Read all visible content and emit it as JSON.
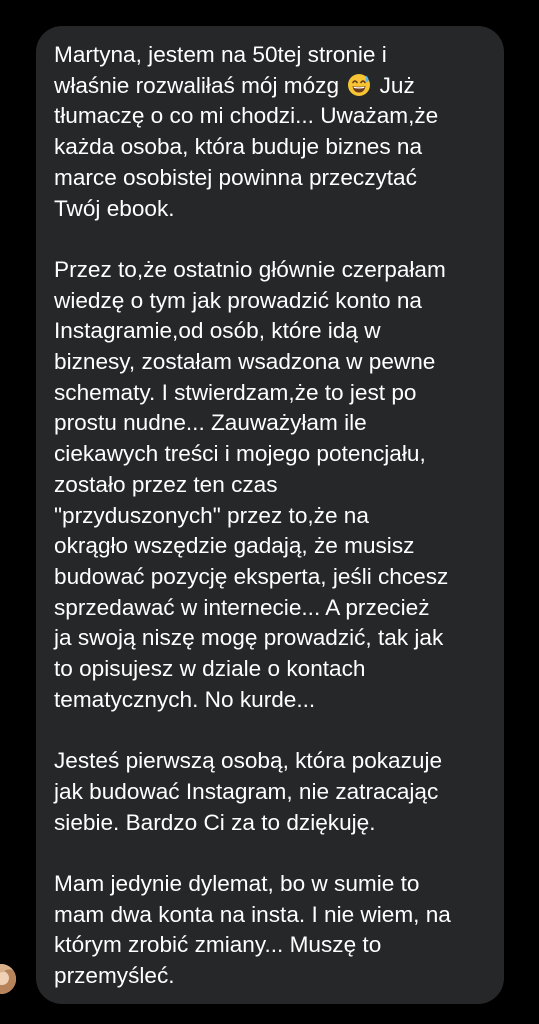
{
  "message": {
    "paragraphs": [
      {
        "before_emoji": "Martyna, jestem na 50tej stronie i\nwłaśnie rozwaliłaś mój mózg ",
        "emoji": "grinning-face-with-sweat-icon",
        "after_emoji": " Już\ntłumaczę o co mi chodzi... Uważam,że\nkażda osoba, która buduje biznes na\nmarce osobistej powinna przeczytać\nTwój ebook."
      },
      {
        "text": "Przez to,że ostatnio głównie czerpałam\nwiedzę o tym jak prowadzić konto na\nInstagramie,od osób, które idą w\nbiznesy, zostałam wsadzona w pewne\nschematy. I stwierdzam,że to jest po\nprostu nudne... Zauważyłam ile\nciekawych treści i mojego potencjału,\nzostało przez ten czas\n\"przyduszonych\" przez to,że na\nokrągło wszędzie gadają, że musisz\nbudować pozycję eksperta, jeśli chcesz\nsprzedawać w internecie... A przecież\nja swoją niszę mogę prowadzić, tak jak\nto opisujesz w dziale o kontach\ntematycznych. No kurde..."
      },
      {
        "text": "Jesteś pierwszą osobą, która pokazuje\njak budować Instagram, nie zatracając\nsiebie. Bardzo Ci za to dziękuję."
      },
      {
        "text": "Mam jedynie dylemat, bo w sumie to\nmam dwa konta na insta. I nie wiem, na\nktórym zrobić zmiany... Muszę to\nprzemyśleć."
      }
    ]
  },
  "sender": {
    "avatar": "sender-avatar-photo"
  },
  "colors": {
    "background": "#000000",
    "bubble": "#262729",
    "text": "#ffffff"
  }
}
